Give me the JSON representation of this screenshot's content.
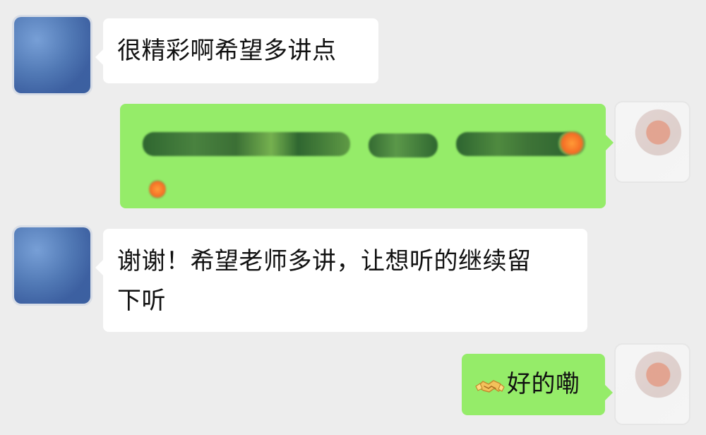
{
  "chat": {
    "messages": [
      {
        "side": "left",
        "text": "很精彩啊希望多讲点"
      },
      {
        "side": "right",
        "text": ""
      },
      {
        "side": "left",
        "text_lines": [
          "谢谢！希望老师多讲，让想听的继续留",
          "下听"
        ]
      },
      {
        "side": "right",
        "text": "好的嘞",
        "icon": "handshake-icon"
      }
    ]
  },
  "colors": {
    "background": "#ededed",
    "incoming_bubble": "#ffffff",
    "outgoing_bubble": "#95ec69",
    "text": "#111111"
  }
}
